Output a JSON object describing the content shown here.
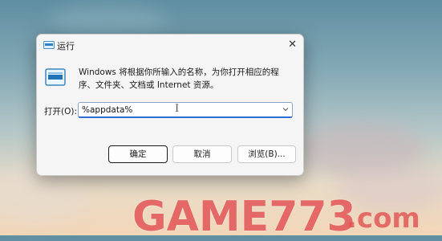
{
  "dialog": {
    "title": "运行",
    "close_symbol": "✕",
    "description": "Windows 将根据你所输入的名称，为你打开相应的程序、文件夹、文档或 Internet 资源。",
    "open_label": "打开(O):",
    "open_value": "%appdata%",
    "text_cursor": "I",
    "ok_label": "确定",
    "cancel_label": "取消",
    "browse_label": "浏览(B)..."
  },
  "watermark": {
    "text": "GAME773",
    "domain": ".com"
  },
  "icons": [
    "run-app-icon",
    "close-icon",
    "chevron-down-icon"
  ],
  "colors": {
    "focus_border": "#2c6fd1",
    "watermark": "#e15050"
  }
}
